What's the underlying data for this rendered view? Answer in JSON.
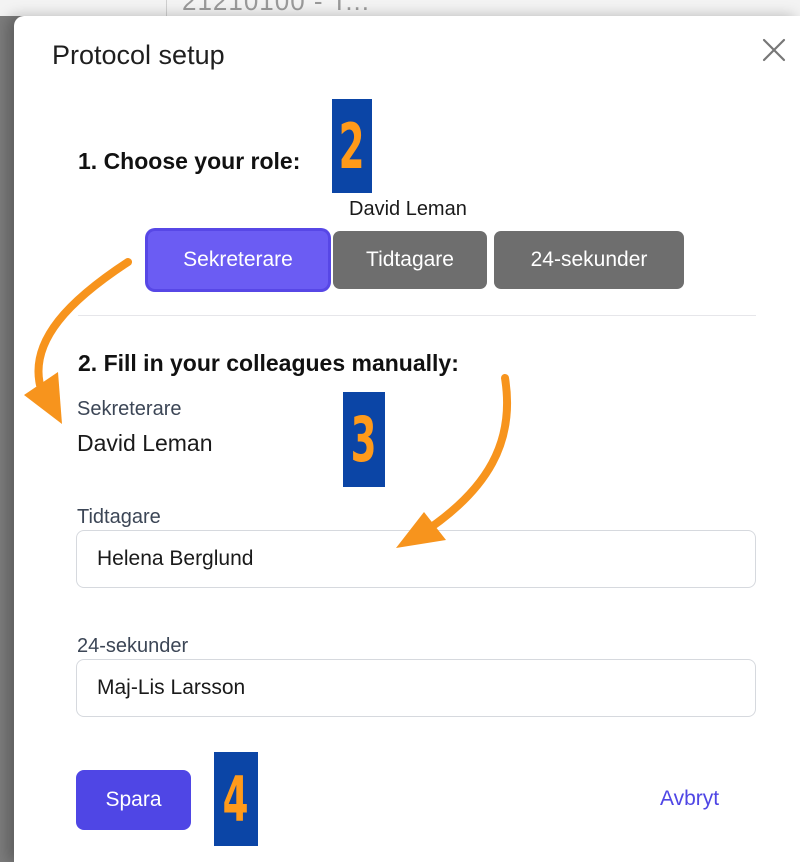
{
  "background": {
    "partial_text": "21210100 - T..."
  },
  "modal": {
    "title": "Protocol setup",
    "close_icon": "close-icon"
  },
  "role_section": {
    "heading": "1. Choose your role:",
    "current_user": "David Leman",
    "buttons": [
      {
        "label": "Sekreterare",
        "selected": true
      },
      {
        "label": "Tidtagare",
        "selected": false
      },
      {
        "label": "24-sekunder",
        "selected": false
      }
    ]
  },
  "colleagues_section": {
    "heading": "2. Fill in your colleagues manually:",
    "sekreterare": {
      "label": "Sekreterare",
      "value": "David Leman"
    },
    "tidtagare": {
      "label": "Tidtagare",
      "value": "Helena Berglund"
    },
    "sekunder24": {
      "label": "24-sekunder",
      "value": "Maj-Lis Larsson"
    }
  },
  "actions": {
    "save_label": "Spara",
    "cancel_label": "Avbryt"
  },
  "annotations": {
    "badges": [
      "2",
      "3",
      "4"
    ]
  },
  "colors": {
    "accent": "#4f46e5",
    "selected_role": "#6b5cf3",
    "unselected_role": "#6e6e6e",
    "badge_bg": "#0b45a6",
    "badge_fg": "#ff9a1a",
    "arrow": "#f7941d"
  }
}
